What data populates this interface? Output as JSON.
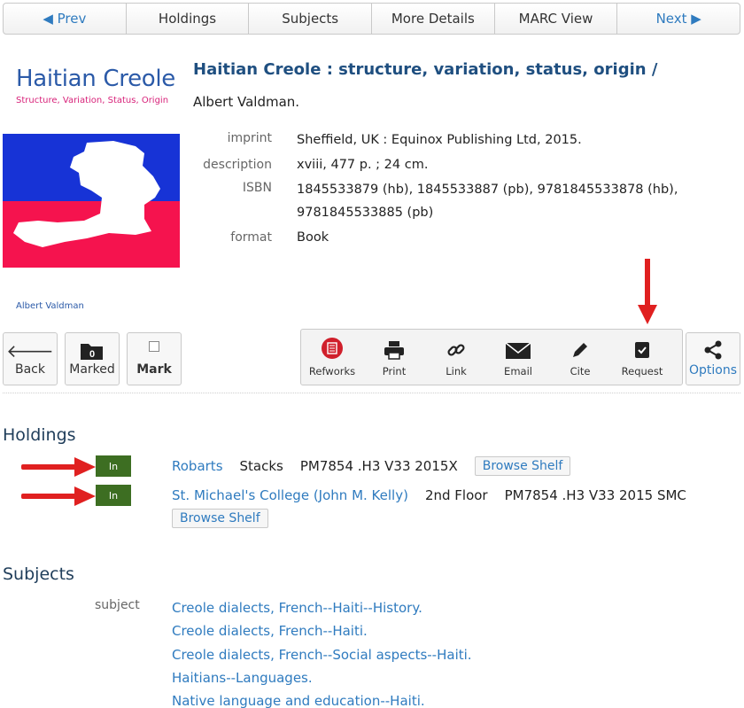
{
  "nav": {
    "prev": "◀ Prev",
    "holdings": "Holdings",
    "subjects": "Subjects",
    "more_details": "More Details",
    "marc_view": "MARC View",
    "next": "Next ▶"
  },
  "cover": {
    "title": "Haitian Creole",
    "subtitle": "Structure, Variation, Status, Origin",
    "author": "Albert Valdman"
  },
  "record": {
    "title": "Haitian Creole : structure, variation, status, origin /",
    "author": "Albert Valdman.",
    "fields": [
      {
        "label": "imprint",
        "value": "Sheffield, UK : Equinox Publishing Ltd, 2015."
      },
      {
        "label": "description",
        "value": "xviii, 477 p. ; 24 cm."
      },
      {
        "label": "ISBN",
        "value": "1845533879 (hb), 1845533887 (pb), 9781845533878 (hb), 9781845533885 (pb)"
      },
      {
        "label": "format",
        "value": "Book"
      }
    ]
  },
  "tools": {
    "back": "Back",
    "marked": "Marked",
    "marked_count": "0",
    "mark": "Mark",
    "refworks": "Refworks",
    "print": "Print",
    "link": "Link",
    "email": "Email",
    "cite": "Cite",
    "request": "Request",
    "options": "Options"
  },
  "holdings": {
    "heading": "Holdings",
    "items": [
      {
        "status": "In",
        "library": "Robarts",
        "location": "Stacks",
        "call_number": "PM7854 .H3 V33 2015X",
        "browse": "Browse Shelf"
      },
      {
        "status": "In",
        "library": "St. Michael's College (John M. Kelly)",
        "location": "2nd Floor",
        "call_number": "PM7854 .H3 V33 2015 SMC",
        "browse": "Browse Shelf"
      }
    ]
  },
  "subjects": {
    "heading": "Subjects",
    "label": "subject",
    "items": [
      "Creole dialects, French--Haiti--History.",
      "Creole dialects, French--Haiti.",
      "Creole dialects, French--Social aspects--Haiti.",
      "Haitians--Languages.",
      "Native language and education--Haiti."
    ]
  },
  "colors": {
    "link": "#2f7bbf",
    "title": "#1f4f80",
    "status_in": "#3d6e22",
    "annotation_arrow": "#e02020",
    "flag_blue": "#1733d6",
    "flag_red": "#f5134e"
  }
}
